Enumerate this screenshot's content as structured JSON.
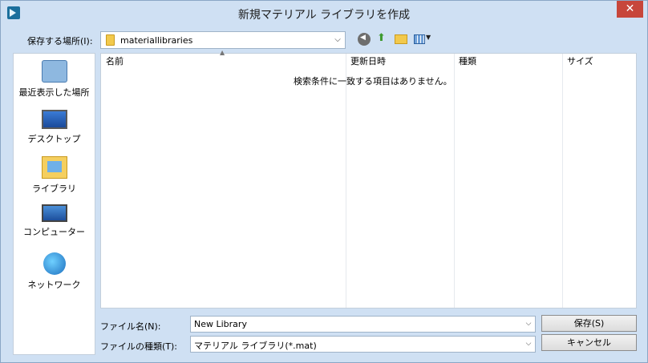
{
  "window": {
    "title": "新規マテリアル ライブラリを作成",
    "close_glyph": "✕"
  },
  "toolbar": {
    "save_in_label": "保存する場所(I):",
    "location": "materiallibraries"
  },
  "places": [
    {
      "label": "最近表示した場所",
      "icon": "recent-places-icon"
    },
    {
      "label": "デスクトップ",
      "icon": "desktop-icon"
    },
    {
      "label": "ライブラリ",
      "icon": "library-icon"
    },
    {
      "label": "コンピューター",
      "icon": "computer-icon"
    },
    {
      "label": "ネットワーク",
      "icon": "network-icon"
    }
  ],
  "file_list": {
    "columns": [
      "名前",
      "更新日時",
      "種類",
      "サイズ"
    ],
    "empty_message": "検索条件に一致する項目はありません。"
  },
  "filename": {
    "label": "ファイル名(N):",
    "value": "New Library"
  },
  "filetype": {
    "label": "ファイルの種類(T):",
    "value": "マテリアル ライブラリ(*.mat)"
  },
  "buttons": {
    "save": "保存(S)",
    "cancel": "キャンセル"
  }
}
